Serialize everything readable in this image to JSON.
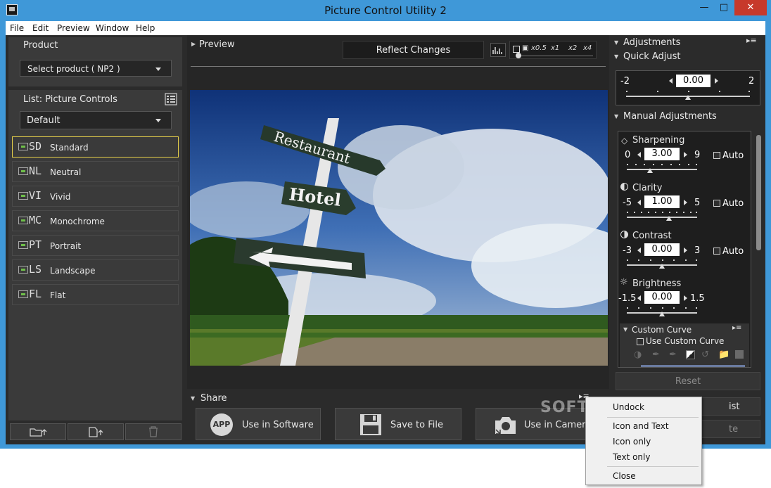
{
  "window": {
    "title": "Picture Control Utility 2"
  },
  "menu": [
    "File",
    "Edit",
    "Preview",
    "Window",
    "Help"
  ],
  "left": {
    "product_header": "Product",
    "product_select": "Select product ( NP2 )",
    "list_header": "List: Picture Controls",
    "list_filter": "Default",
    "picture_controls": [
      {
        "code": "SD",
        "label": "Standard",
        "selected": true
      },
      {
        "code": "NL",
        "label": "Neutral",
        "selected": false
      },
      {
        "code": "VI",
        "label": "Vivid",
        "selected": false
      },
      {
        "code": "MC",
        "label": "Monochrome",
        "selected": false
      },
      {
        "code": "PT",
        "label": "Portrait",
        "selected": false
      },
      {
        "code": "LS",
        "label": "Landscape",
        "selected": false
      },
      {
        "code": "FL",
        "label": "Flat",
        "selected": false
      }
    ]
  },
  "preview": {
    "header": "Preview",
    "reflect_button": "Reflect Changes",
    "zoom_options": [
      "x0.5",
      "x1",
      "x2",
      "x4"
    ],
    "photo_signs": [
      "Restaurant",
      "Hotel"
    ]
  },
  "share": {
    "header": "Share",
    "buttons": [
      "Use in Software",
      "Save to File",
      "Use in Camera"
    ],
    "app_badge": "APP"
  },
  "adjustments": {
    "header": "Adjustments",
    "quick_adjust": {
      "header": "Quick Adjust",
      "min": "-2",
      "max": "2",
      "value": "0.00",
      "position": 0.5
    },
    "manual_header": "Manual Adjustments",
    "auto_label": "Auto",
    "params": [
      {
        "name": "Sharpening",
        "min": "0",
        "max": "9",
        "value": "3.00",
        "auto": true,
        "position": 0.333
      },
      {
        "name": "Clarity",
        "min": "-5",
        "max": "5",
        "value": "1.00",
        "auto": true,
        "position": 0.6
      },
      {
        "name": "Contrast",
        "min": "-3",
        "max": "3",
        "value": "0.00",
        "auto": true,
        "position": 0.5
      },
      {
        "name": "Brightness",
        "min": "-1.5",
        "max": "1.5",
        "value": "0.00",
        "auto": false,
        "position": 0.5
      }
    ],
    "custom_curve": {
      "header": "Custom Curve",
      "checkbox": "Use Custom Curve"
    },
    "reset": "Reset",
    "partial_list_label": "ist",
    "partial_save_label": "te"
  },
  "context_menu": {
    "items": [
      "Undock",
      "Icon and Text",
      "Icon only",
      "Text only",
      "Close"
    ]
  },
  "watermark": "SOFTPEDIA",
  "colors": {
    "title_bar": "#3f98d8",
    "panel_bg": "#3a3a3a",
    "selection": "#e8d24a",
    "close_button": "#c7392b"
  }
}
